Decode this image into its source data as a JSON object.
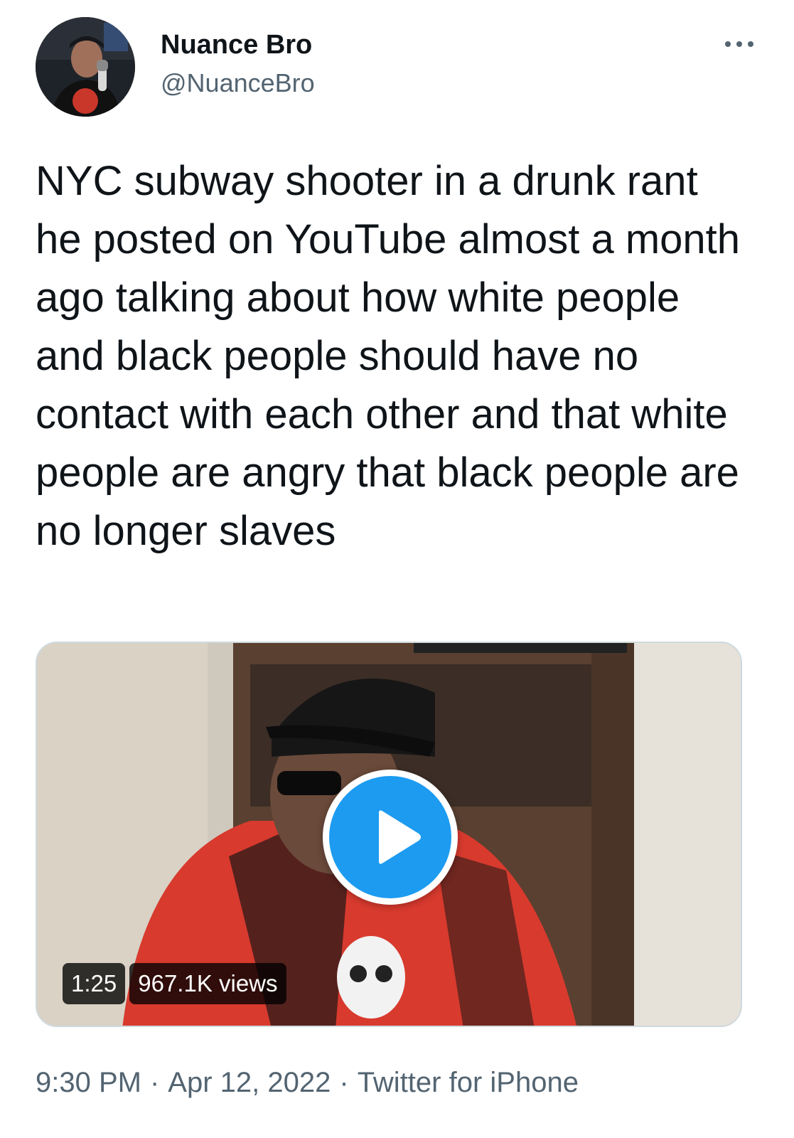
{
  "author": {
    "display_name": "Nuance Bro",
    "handle": "@NuanceBro"
  },
  "more_icon": "more-horizontal-icon",
  "tweet": {
    "text": "NYC subway shooter in a drunk rant he posted on YouTube almost a month ago talking about how white people and black people should have no contact with each other and that white people are angry that black people are no longer slaves"
  },
  "video": {
    "duration": "1:25",
    "views": "967.1K views",
    "play_icon": "play-icon"
  },
  "meta": {
    "time": "9:30 PM",
    "separator": "·",
    "date": "Apr 12, 2022",
    "source": "Twitter for iPhone"
  },
  "colors": {
    "text_primary": "#0f1419",
    "text_secondary": "#536471",
    "accent": "#1d9bf0",
    "border": "#cfd9de"
  }
}
